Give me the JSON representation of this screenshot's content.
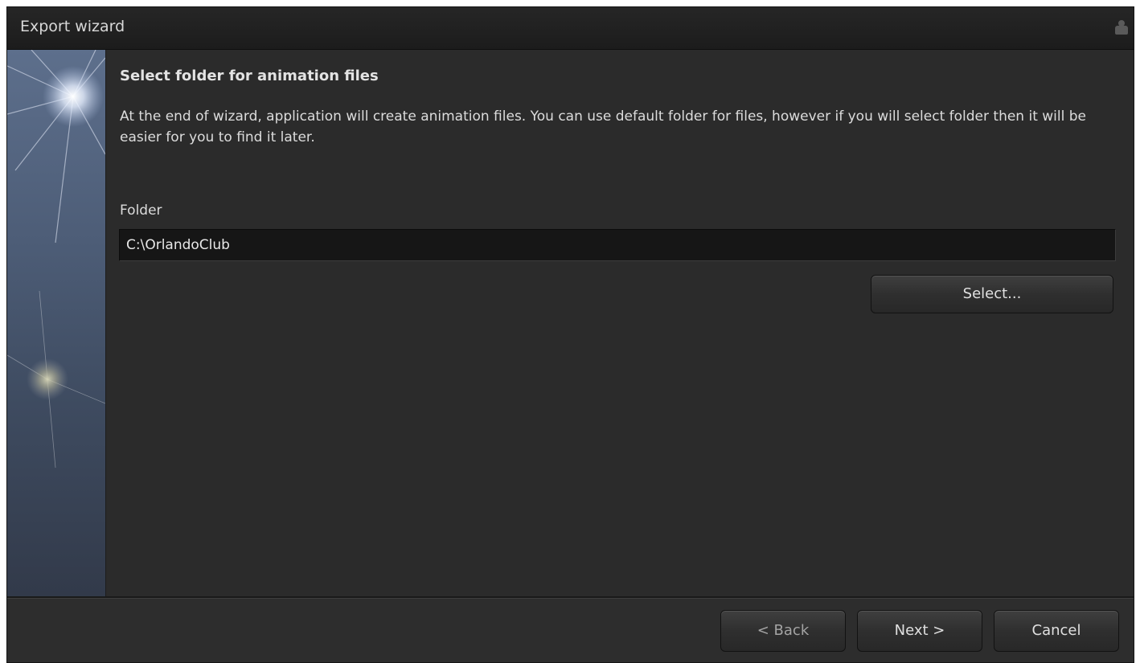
{
  "window": {
    "title": "Export wizard",
    "title_button_icon": "user-icon"
  },
  "sidebar": {
    "image": "starburst-graphic"
  },
  "page": {
    "heading": "Select folder for animation files",
    "description": "At the end of wizard, application will create animation files. You can use default folder for files, however if you will select folder then it will be easier for you to find it later.",
    "folder_label": "Folder",
    "folder_value": "C:\\OrlandoClub",
    "select_button": "Select..."
  },
  "footer": {
    "back_label": "< Back",
    "back_enabled": false,
    "next_label": "Next >",
    "cancel_label": "Cancel"
  },
  "colors": {
    "background": "#2b2b2b",
    "titlebar": "#1f1f1f",
    "text": "#dcdcdc",
    "disabled_text": "#a4a4a4",
    "input_bg": "#161616"
  }
}
